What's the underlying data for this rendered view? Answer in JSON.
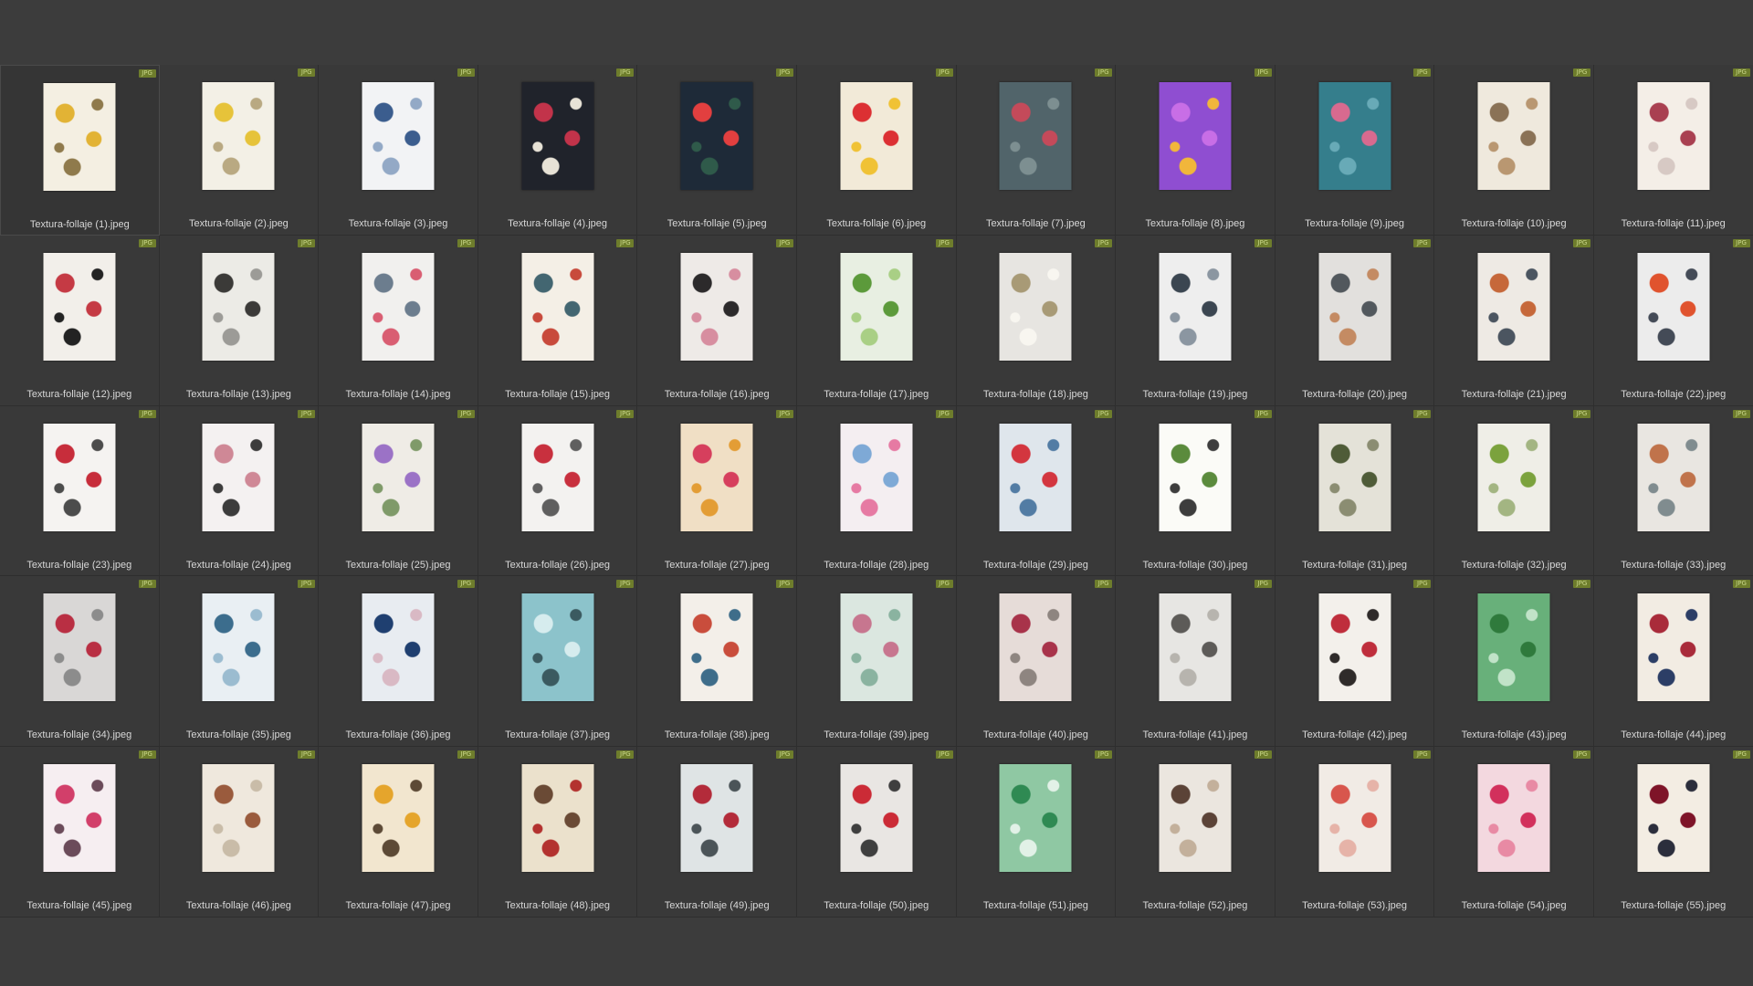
{
  "file_type_badge": "JPG",
  "files": [
    {
      "name": "Textura-follaje (1).jpeg",
      "palette": [
        "#f4efe2",
        "#e2b335",
        "#8f7a4c"
      ]
    },
    {
      "name": "Textura-follaje (2).jpeg",
      "palette": [
        "#f3f0e6",
        "#e6c33a",
        "#b9a982"
      ]
    },
    {
      "name": "Textura-follaje (3).jpeg",
      "palette": [
        "#f2f3f5",
        "#3b5d8e",
        "#93a9c6"
      ]
    },
    {
      "name": "Textura-follaje (4).jpeg",
      "palette": [
        "#20232b",
        "#c2334a",
        "#e7e2d6"
      ]
    },
    {
      "name": "Textura-follaje (5).jpeg",
      "palette": [
        "#1e2a38",
        "#e23f3f",
        "#2f5a4a"
      ]
    },
    {
      "name": "Textura-follaje (6).jpeg",
      "palette": [
        "#f2ead8",
        "#dc3033",
        "#f0c235"
      ]
    },
    {
      "name": "Textura-follaje (7).jpeg",
      "palette": [
        "#51646a",
        "#c44a5a",
        "#7d8f91"
      ]
    },
    {
      "name": "Textura-follaje (8).jpeg",
      "palette": [
        "#8f4ed1",
        "#c86ee6",
        "#f1b63b"
      ]
    },
    {
      "name": "Textura-follaje (9).jpeg",
      "palette": [
        "#357e8c",
        "#d86a8f",
        "#68aab7"
      ]
    },
    {
      "name": "Textura-follaje (10).jpeg",
      "palette": [
        "#efe9dd",
        "#8a7256",
        "#b99771"
      ]
    },
    {
      "name": "Textura-follaje (11).jpeg",
      "palette": [
        "#f4eee7",
        "#a94051",
        "#d7c9c4"
      ]
    },
    {
      "name": "Textura-follaje (12).jpeg",
      "palette": [
        "#f2efea",
        "#c53a44",
        "#232323"
      ]
    },
    {
      "name": "Textura-follaje (13).jpeg",
      "palette": [
        "#ecebe6",
        "#3b3a38",
        "#9c9b97"
      ]
    },
    {
      "name": "Textura-follaje (14).jpeg",
      "palette": [
        "#f1f0ee",
        "#6c7d8e",
        "#d95e72"
      ]
    },
    {
      "name": "Textura-follaje (15).jpeg",
      "palette": [
        "#f4efe6",
        "#436671",
        "#c84a3c"
      ]
    },
    {
      "name": "Textura-follaje (16).jpeg",
      "palette": [
        "#eeeae7",
        "#2c2a2b",
        "#d78ea0"
      ]
    },
    {
      "name": "Textura-follaje (17).jpeg",
      "palette": [
        "#e8efe2",
        "#5c9a3b",
        "#a9cf85"
      ]
    },
    {
      "name": "Textura-follaje (18).jpeg",
      "palette": [
        "#e7e5e1",
        "#a89a76",
        "#f8f6f0"
      ]
    },
    {
      "name": "Textura-follaje (19).jpeg",
      "palette": [
        "#eeeeee",
        "#3b4651",
        "#8b96a1"
      ]
    },
    {
      "name": "Textura-follaje (20).jpeg",
      "palette": [
        "#e2e0dd",
        "#52585d",
        "#c48b63"
      ]
    },
    {
      "name": "Textura-follaje (21).jpeg",
      "palette": [
        "#eeeae4",
        "#c6683a",
        "#4b5560"
      ]
    },
    {
      "name": "Textura-follaje (22).jpeg",
      "palette": [
        "#ececec",
        "#e0532e",
        "#444b57"
      ]
    },
    {
      "name": "Textura-follaje (23).jpeg",
      "palette": [
        "#f5f3f1",
        "#c72d3b",
        "#4c4c4c"
      ]
    },
    {
      "name": "Textura-follaje (24).jpeg",
      "palette": [
        "#f4f1f1",
        "#cf8896",
        "#3c3c3c"
      ]
    },
    {
      "name": "Textura-follaje (25).jpeg",
      "palette": [
        "#efece6",
        "#9b72c6",
        "#7f9a69"
      ]
    },
    {
      "name": "Textura-follaje (26).jpeg",
      "palette": [
        "#f3f2f0",
        "#c8303e",
        "#5f5f5f"
      ]
    },
    {
      "name": "Textura-follaje (27).jpeg",
      "palette": [
        "#f0dfc5",
        "#d63f5d",
        "#e39d35"
      ]
    },
    {
      "name": "Textura-follaje (28).jpeg",
      "palette": [
        "#f4eef1",
        "#7ea9d6",
        "#e67aa3"
      ]
    },
    {
      "name": "Textura-follaje (29).jpeg",
      "palette": [
        "#dfe6ec",
        "#d3363f",
        "#527ca4"
      ]
    },
    {
      "name": "Textura-follaje (30).jpeg",
      "palette": [
        "#fbfbf7",
        "#5b8b3d",
        "#3d3d3d"
      ]
    },
    {
      "name": "Textura-follaje (31).jpeg",
      "palette": [
        "#e4e2d8",
        "#4f5c38",
        "#8b8d72"
      ]
    },
    {
      "name": "Textura-follaje (32).jpeg",
      "palette": [
        "#efeee7",
        "#7ba23d",
        "#a3b582"
      ]
    },
    {
      "name": "Textura-follaje (33).jpeg",
      "palette": [
        "#e9e6e1",
        "#c0734b",
        "#808c8f"
      ]
    },
    {
      "name": "Textura-follaje (34).jpeg",
      "palette": [
        "#d9d7d6",
        "#b92f43",
        "#8c8c8c"
      ]
    },
    {
      "name": "Textura-follaje (35).jpeg",
      "palette": [
        "#e9eff3",
        "#3c6d8d",
        "#9bbcd0"
      ]
    },
    {
      "name": "Textura-follaje (36).jpeg",
      "palette": [
        "#e8ecf1",
        "#1f3f70",
        "#d9b9c4"
      ]
    },
    {
      "name": "Textura-follaje (37).jpeg",
      "palette": [
        "#8cc3cb",
        "#d6ecee",
        "#3b5a60"
      ]
    },
    {
      "name": "Textura-follaje (38).jpeg",
      "palette": [
        "#f3efe9",
        "#c94d3c",
        "#3e6d8a"
      ]
    },
    {
      "name": "Textura-follaje (39).jpeg",
      "palette": [
        "#dbe7e0",
        "#c7768f",
        "#8ab3a0"
      ]
    },
    {
      "name": "Textura-follaje (40).jpeg",
      "palette": [
        "#e6dcd8",
        "#a8334a",
        "#8e8580"
      ]
    },
    {
      "name": "Textura-follaje (41).jpeg",
      "palette": [
        "#e7e6e3",
        "#5d5b58",
        "#b7b4ae"
      ]
    },
    {
      "name": "Textura-follaje (42).jpeg",
      "palette": [
        "#f3f0eb",
        "#bf2e3c",
        "#2f2b2a"
      ]
    },
    {
      "name": "Textura-follaje (43).jpeg",
      "palette": [
        "#68b07a",
        "#2f7a3c",
        "#c1e3c8"
      ]
    },
    {
      "name": "Textura-follaje (44).jpeg",
      "palette": [
        "#f2ece3",
        "#a92b3a",
        "#2c3e66"
      ]
    },
    {
      "name": "Textura-follaje (45).jpeg",
      "palette": [
        "#f6eef1",
        "#d23f6a",
        "#6b4b5a"
      ]
    },
    {
      "name": "Textura-follaje (46).jpeg",
      "palette": [
        "#efe8dd",
        "#9a5b3d",
        "#c9bca8"
      ]
    },
    {
      "name": "Textura-follaje (47).jpeg",
      "palette": [
        "#f2e6cf",
        "#e5a52c",
        "#5d4a36"
      ]
    },
    {
      "name": "Textura-follaje (48).jpeg",
      "palette": [
        "#ebe1cc",
        "#6a4a35",
        "#b3322f"
      ]
    },
    {
      "name": "Textura-follaje (49).jpeg",
      "palette": [
        "#dfe4e5",
        "#b32b3a",
        "#4b5458"
      ]
    },
    {
      "name": "Textura-follaje (50).jpeg",
      "palette": [
        "#e9e6e3",
        "#cb2b36",
        "#3f3f3f"
      ]
    },
    {
      "name": "Textura-follaje (51).jpeg",
      "palette": [
        "#8fc8a3",
        "#2f8a53",
        "#e2f1e7"
      ]
    },
    {
      "name": "Textura-follaje (52).jpeg",
      "palette": [
        "#ebe6df",
        "#5b4337",
        "#c3b09b"
      ]
    },
    {
      "name": "Textura-follaje (53).jpeg",
      "palette": [
        "#f1ebe5",
        "#d8564d",
        "#e6b3a8"
      ]
    },
    {
      "name": "Textura-follaje (54).jpeg",
      "palette": [
        "#f3d8df",
        "#d2305c",
        "#e88aa4"
      ]
    },
    {
      "name": "Textura-follaje (55).jpeg",
      "palette": [
        "#f3ede3",
        "#7e1428",
        "#2b2e3c"
      ]
    }
  ]
}
